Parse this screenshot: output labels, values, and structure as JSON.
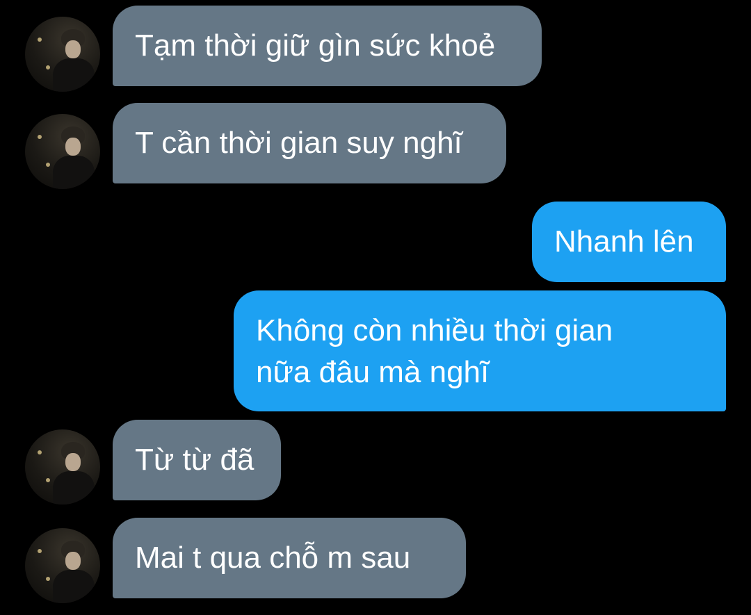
{
  "conversation": {
    "messages": [
      {
        "sender": "them",
        "text": "Tạm thời giữ gìn sức khoẻ"
      },
      {
        "sender": "them",
        "text": "T cần thời gian suy nghĩ"
      },
      {
        "sender": "me",
        "text": "Nhanh lên"
      },
      {
        "sender": "me",
        "text": "Không còn nhiều thời gian\nnữa đâu mà nghĩ"
      },
      {
        "sender": "them",
        "text": "Từ từ đã"
      },
      {
        "sender": "them",
        "text": "Mai t qua chỗ m sau"
      }
    ]
  },
  "colors": {
    "background": "#000000",
    "incoming_bubble": "#657786",
    "outgoing_bubble": "#1da1f2",
    "text": "#ffffff"
  }
}
